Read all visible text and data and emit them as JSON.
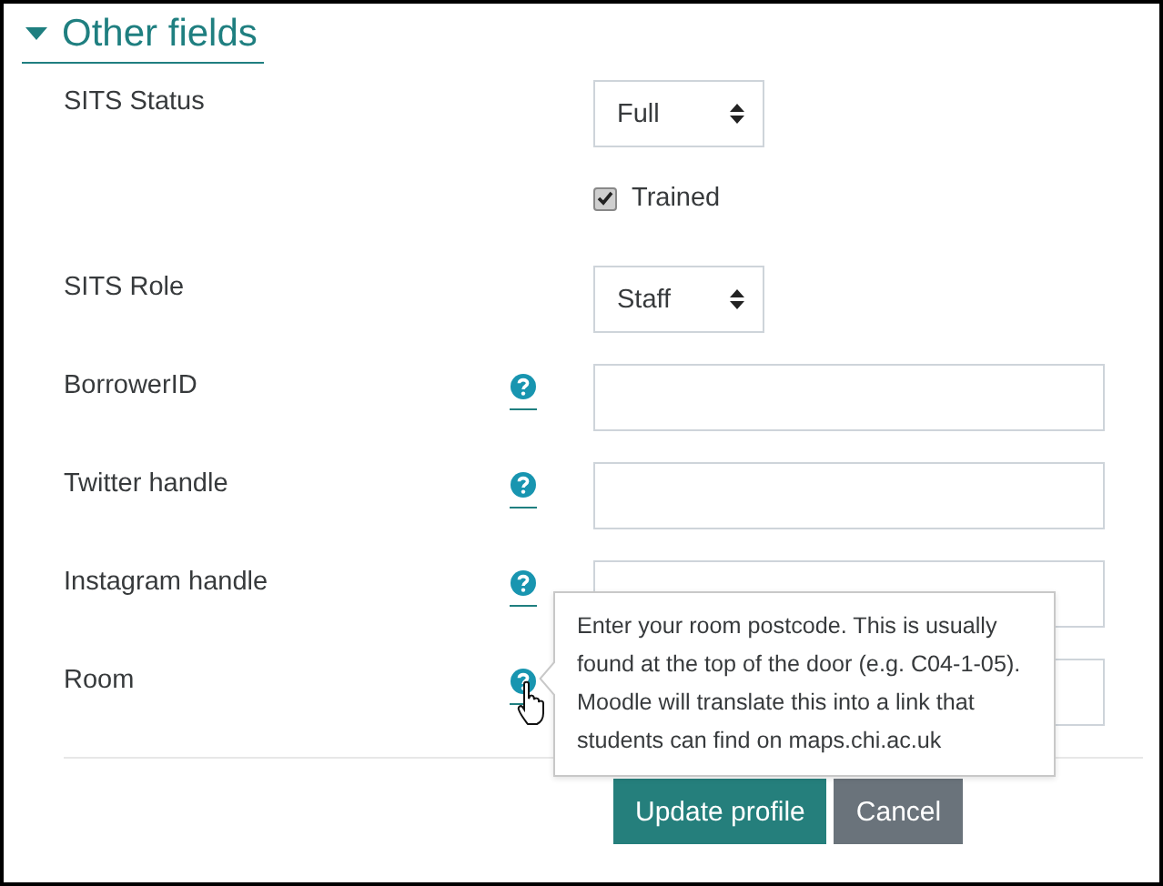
{
  "section": {
    "title": "Other fields",
    "expanded": true
  },
  "fields": [
    {
      "kind": "select",
      "label": "SITS Status",
      "value": "Full",
      "help": false
    },
    {
      "kind": "checkbox",
      "label": "Trained",
      "checked": true,
      "help": false
    },
    {
      "kind": "select",
      "label": "SITS Role",
      "value": "Staff",
      "help": false
    },
    {
      "kind": "text",
      "label": "BorrowerID",
      "help": true
    },
    {
      "kind": "text",
      "label": "Twitter handle",
      "help": true
    },
    {
      "kind": "text",
      "label": "Instagram handle",
      "help": true
    },
    {
      "kind": "text",
      "label": "Room",
      "help": true
    }
  ],
  "tooltip": {
    "text": "Enter your room postcode. This is usually found at the top of the door (e.g. C04-1-05). Moodle will translate this into a link that students can find on maps.chi.ac.uk"
  },
  "buttons": [
    {
      "kind": "primary",
      "label": "Update profile"
    },
    {
      "kind": "secondary",
      "label": "Cancel"
    }
  ]
}
